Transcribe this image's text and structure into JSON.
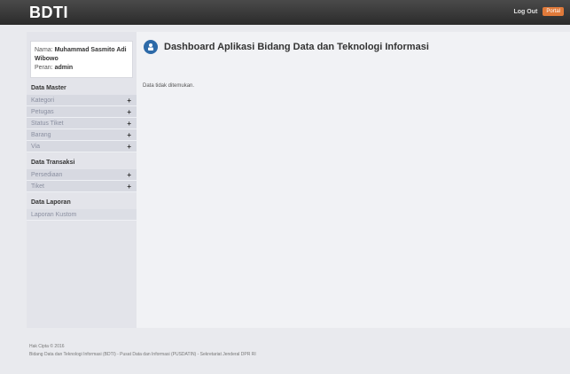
{
  "header": {
    "brand": "BDTI",
    "logout_label": "Log Out",
    "portal_label": "Portal"
  },
  "sidebar": {
    "user": {
      "name_label": "Nama:",
      "name_value": "Muhammad Sasmito Adi Wibowo",
      "role_label": "Peran:",
      "role_value": "admin"
    },
    "sections": [
      {
        "title": "Data Master",
        "items": [
          {
            "label": "Kategori",
            "expandable": true
          },
          {
            "label": "Petugas",
            "expandable": true
          },
          {
            "label": "Status Tiket",
            "expandable": true
          },
          {
            "label": "Barang",
            "expandable": true
          },
          {
            "label": "Via",
            "expandable": true
          }
        ]
      },
      {
        "title": "Data Transaksi",
        "items": [
          {
            "label": "Persediaan",
            "expandable": true
          },
          {
            "label": "Tiket",
            "expandable": true
          }
        ]
      },
      {
        "title": "Data Laporan",
        "items": [
          {
            "label": "Laporan Kustom",
            "expandable": false
          }
        ]
      }
    ]
  },
  "main": {
    "title": "Dashboard Aplikasi Bidang Data dan Teknologi Informasi",
    "empty_message": "Data tidak ditemukan."
  },
  "footer": {
    "copyright": "Hak Cipta © 2016",
    "credits": "Bidang Data dan Teknologi Informasi (BDTI) - Pusat Data dan Informasi (PUSDATIN) - Sekretariat Jenderal DPR RI"
  },
  "colors": {
    "topbar": "#2b2b2b",
    "accent": "#e07a3a",
    "title_icon": "#2d6aa8"
  }
}
